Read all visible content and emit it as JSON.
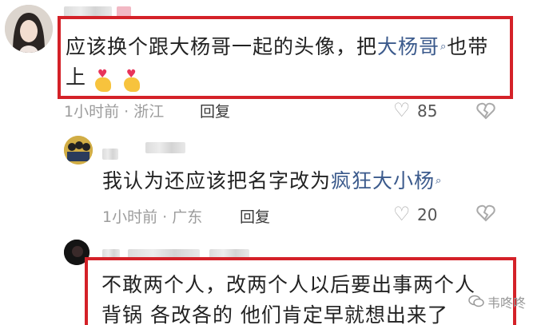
{
  "comments": [
    {
      "text_prefix": "应该换个跟大杨哥一起的头像，把",
      "keyword": "大杨哥",
      "text_suffix": "也带",
      "text_line2": "上",
      "emoji": [
        "hand-heart-emoji",
        "hand-heart-emoji"
      ],
      "time": "1小时前 · 浙江",
      "reply": "回复",
      "likes": "85"
    },
    {
      "text_prefix": "我认为还应该把名字改为",
      "keyword": "疯狂大小杨",
      "time": "1小时前 · 广东",
      "reply": "回复",
      "likes": "20"
    },
    {
      "line1": "不敢两个人，改两个人以后要出事两个人",
      "line2": "背锅 各改各的 他们肯定早就想出来了"
    }
  ],
  "search_icon": "search-icon",
  "like_icon": "heart-outline-icon",
  "dislike_icon": "broken-heart-icon",
  "watermark": "韦咚咚",
  "colors": {
    "highlight_border": "#d42128",
    "keyword": "#3b5a8c",
    "meta": "#9c9c9c"
  }
}
